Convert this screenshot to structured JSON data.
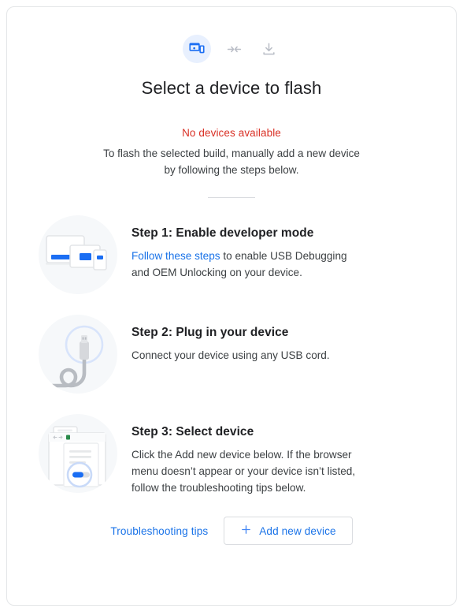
{
  "header": {
    "icons": [
      {
        "name": "devices-icon",
        "state": "active"
      },
      {
        "name": "connect-arrows-icon",
        "state": "inactive"
      },
      {
        "name": "download-icon",
        "state": "inactive"
      }
    ],
    "title": "Select a device to flash"
  },
  "status": {
    "error": "No devices available",
    "description": "To flash the selected build, manually add a new device by following the steps below."
  },
  "steps": [
    {
      "title": "Step 1: Enable developer mode",
      "link_text": "Follow these steps",
      "text_after_link": " to enable USB Debugging and OEM Unlocking on your device.",
      "art": "devices-illustration"
    },
    {
      "title": "Step 2: Plug in your device",
      "text": "Connect your device using any USB cord.",
      "art": "usb-cable-illustration"
    },
    {
      "title": "Step 3: Select device",
      "text": "Click the Add new device below. If the browser menu doesn’t appear or your device isn’t listed, follow the troubleshooting tips below.",
      "art": "browser-picker-illustration"
    }
  ],
  "actions": {
    "troubleshooting_label": "Troubleshooting tips",
    "add_device_label": "Add new device",
    "add_device_icon": "plus-icon"
  },
  "colors": {
    "accent_blue": "#1a73e8",
    "icon_blue": "#1b6ef3",
    "error_red": "#d93025",
    "chip_bg": "#e8f0fe",
    "art_bg": "#f6f8fa",
    "text_primary": "#202124",
    "text_secondary": "#3c4043",
    "border": "#dadce0"
  }
}
